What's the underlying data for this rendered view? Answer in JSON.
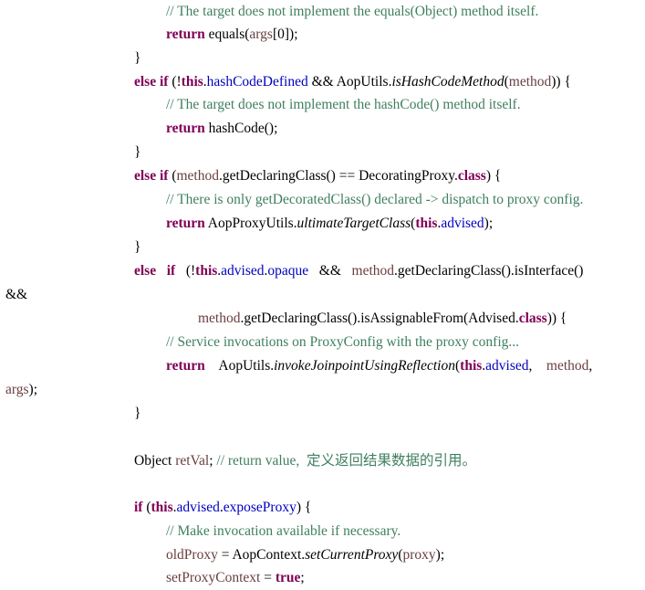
{
  "document": {
    "language": "java",
    "lines": [
      {
        "level": 2,
        "tokens": [
          {
            "t": "// The target does not implement the equals(Object) method itself.",
            "c": "cmt"
          }
        ]
      },
      {
        "level": 2,
        "tokens": [
          {
            "t": "return",
            "c": "kw"
          },
          {
            "t": " equals(",
            "c": ""
          },
          {
            "t": "args",
            "c": "var"
          },
          {
            "t": "[0]);",
            "c": ""
          }
        ]
      },
      {
        "level": 1,
        "tokens": [
          {
            "t": "}",
            "c": ""
          }
        ]
      },
      {
        "level": 1,
        "tokens": [
          {
            "t": "else if",
            "c": "kw"
          },
          {
            "t": " (!",
            "c": ""
          },
          {
            "t": "this",
            "c": "kw"
          },
          {
            "t": ".",
            "c": ""
          },
          {
            "t": "hashCodeDefined",
            "c": "fld"
          },
          {
            "t": " && AopUtils.",
            "c": ""
          },
          {
            "t": "isHashCodeMethod",
            "c": "it"
          },
          {
            "t": "(",
            "c": ""
          },
          {
            "t": "method",
            "c": "var"
          },
          {
            "t": ")) {",
            "c": ""
          }
        ]
      },
      {
        "level": 2,
        "tokens": [
          {
            "t": "// The target does not implement the hashCode() method itself.",
            "c": "cmt"
          }
        ]
      },
      {
        "level": 2,
        "tokens": [
          {
            "t": "return",
            "c": "kw"
          },
          {
            "t": " hashCode();",
            "c": ""
          }
        ]
      },
      {
        "level": 1,
        "tokens": [
          {
            "t": "}",
            "c": ""
          }
        ]
      },
      {
        "level": 1,
        "tokens": [
          {
            "t": "else if",
            "c": "kw"
          },
          {
            "t": " (",
            "c": ""
          },
          {
            "t": "method",
            "c": "var"
          },
          {
            "t": ".getDeclaringClass() == DecoratingProxy.",
            "c": ""
          },
          {
            "t": "class",
            "c": "kw"
          },
          {
            "t": ") {",
            "c": ""
          }
        ]
      },
      {
        "level": 2,
        "tokens": [
          {
            "t": "// There is only getDecoratedClass() declared -> dispatch to proxy config.",
            "c": "cmt"
          }
        ]
      },
      {
        "level": 2,
        "tokens": [
          {
            "t": "return",
            "c": "kw"
          },
          {
            "t": " AopProxyUtils.",
            "c": ""
          },
          {
            "t": "ultimateTargetClass",
            "c": "it"
          },
          {
            "t": "(",
            "c": ""
          },
          {
            "t": "this",
            "c": "kw"
          },
          {
            "t": ".",
            "c": ""
          },
          {
            "t": "advised",
            "c": "fld"
          },
          {
            "t": ");",
            "c": ""
          }
        ]
      },
      {
        "level": 1,
        "tokens": [
          {
            "t": "}",
            "c": ""
          }
        ]
      },
      {
        "level": 1,
        "tokens": [
          {
            "t": "else   if   ",
            "c": "kw"
          },
          {
            "t": "(!",
            "c": ""
          },
          {
            "t": "this",
            "c": "kw"
          },
          {
            "t": ".",
            "c": ""
          },
          {
            "t": "advised",
            "c": "fld"
          },
          {
            "t": ".",
            "c": ""
          },
          {
            "t": "opaque",
            "c": "fld"
          },
          {
            "t": "   &&   ",
            "c": ""
          },
          {
            "t": "method",
            "c": "var"
          },
          {
            "t": ".getDeclaringClass().isInterface()",
            "c": ""
          }
        ]
      },
      {
        "level": 0,
        "tokens": [
          {
            "t": "&&",
            "c": ""
          }
        ]
      },
      {
        "level": 3,
        "tokens": [
          {
            "t": "method",
            "c": "var"
          },
          {
            "t": ".getDeclaringClass().isAssignableFrom(Advised.",
            "c": ""
          },
          {
            "t": "class",
            "c": "kw"
          },
          {
            "t": ")) {",
            "c": ""
          }
        ]
      },
      {
        "level": 2,
        "tokens": [
          {
            "t": "// Service invocations on ProxyConfig with the proxy config...",
            "c": "cmt"
          }
        ]
      },
      {
        "level": 2,
        "tokens": [
          {
            "t": "return",
            "c": "kw"
          },
          {
            "t": "    AopUtils.",
            "c": ""
          },
          {
            "t": "invokeJoinpointUsingReflection",
            "c": "it"
          },
          {
            "t": "(",
            "c": ""
          },
          {
            "t": "this",
            "c": "kw"
          },
          {
            "t": ".",
            "c": ""
          },
          {
            "t": "advised",
            "c": "fld"
          },
          {
            "t": ",    ",
            "c": ""
          },
          {
            "t": "method",
            "c": "var"
          },
          {
            "t": ",",
            "c": ""
          }
        ]
      },
      {
        "level": 0,
        "tokens": [
          {
            "t": "args",
            "c": "var"
          },
          {
            "t": ");",
            "c": ""
          }
        ]
      },
      {
        "level": 1,
        "tokens": [
          {
            "t": "}",
            "c": ""
          }
        ]
      },
      {
        "level": 1,
        "tokens": [
          {
            "t": "Object ",
            "c": ""
          },
          {
            "t": "retVal",
            "c": "var"
          },
          {
            "t": "; ",
            "c": ""
          },
          {
            "t": "// return value,  定义返回结果数据的引用。",
            "c": "cmt"
          }
        ]
      },
      {
        "level": 1,
        "tokens": [
          {
            "t": "if",
            "c": "kw"
          },
          {
            "t": " (",
            "c": ""
          },
          {
            "t": "this",
            "c": "kw"
          },
          {
            "t": ".",
            "c": ""
          },
          {
            "t": "advised",
            "c": "fld"
          },
          {
            "t": ".",
            "c": ""
          },
          {
            "t": "exposeProxy",
            "c": "fld"
          },
          {
            "t": ") {",
            "c": ""
          }
        ]
      },
      {
        "level": 2,
        "tokens": [
          {
            "t": "// Make invocation available if necessary.",
            "c": "cmt"
          }
        ]
      },
      {
        "level": 2,
        "tokens": [
          {
            "t": "oldProxy",
            "c": "var"
          },
          {
            "t": " = AopContext.",
            "c": ""
          },
          {
            "t": "setCurrentProxy",
            "c": "it"
          },
          {
            "t": "(",
            "c": ""
          },
          {
            "t": "proxy",
            "c": "var"
          },
          {
            "t": ");",
            "c": ""
          }
        ]
      },
      {
        "level": 2,
        "tokens": [
          {
            "t": "setProxyContext",
            "c": "var"
          },
          {
            "t": " = ",
            "c": ""
          },
          {
            "t": "true",
            "c": "kw"
          },
          {
            "t": ";",
            "c": ""
          }
        ]
      }
    ]
  },
  "colors": {
    "keyword": "#7f0055",
    "field": "#0000c0",
    "variable": "#6a3e3e",
    "comment": "#3f7f5f",
    "text": "#000000",
    "background": "#ffffff"
  }
}
